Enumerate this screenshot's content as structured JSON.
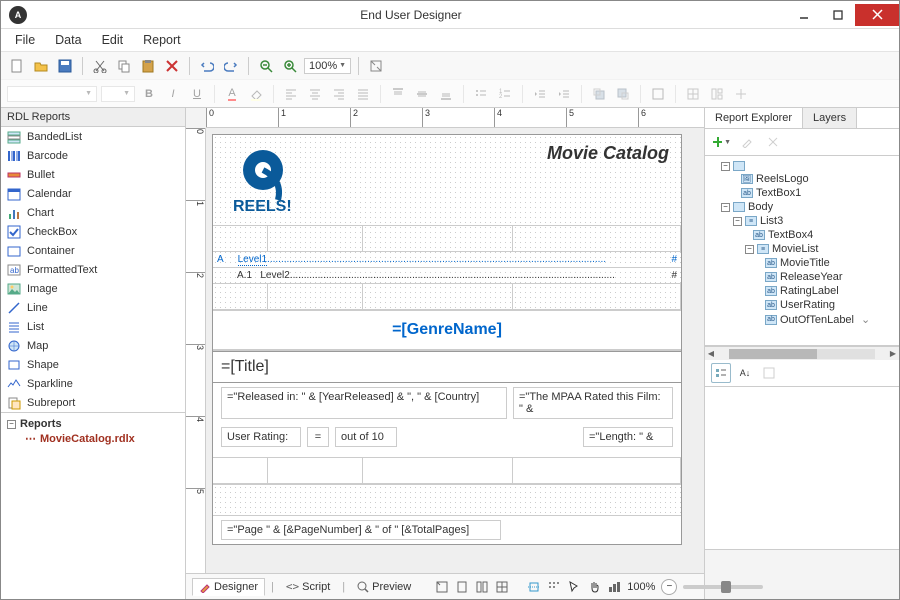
{
  "window": {
    "title": "End User Designer"
  },
  "menu": {
    "file": "File",
    "data": "Data",
    "edit": "Edit",
    "report": "Report"
  },
  "toolbar": {
    "zoom": "100%"
  },
  "left": {
    "header": "RDL Reports",
    "items": [
      {
        "label": "BandedList",
        "icon": "bandedlist"
      },
      {
        "label": "Barcode",
        "icon": "barcode"
      },
      {
        "label": "Bullet",
        "icon": "bullet"
      },
      {
        "label": "Calendar",
        "icon": "calendar"
      },
      {
        "label": "Chart",
        "icon": "chart"
      },
      {
        "label": "CheckBox",
        "icon": "checkbox"
      },
      {
        "label": "Container",
        "icon": "container"
      },
      {
        "label": "FormattedText",
        "icon": "formattedtext"
      },
      {
        "label": "Image",
        "icon": "image"
      },
      {
        "label": "Line",
        "icon": "line"
      },
      {
        "label": "List",
        "icon": "list"
      },
      {
        "label": "Map",
        "icon": "map"
      },
      {
        "label": "Shape",
        "icon": "shape"
      },
      {
        "label": "Sparkline",
        "icon": "sparkline"
      },
      {
        "label": "Subreport",
        "icon": "subreport"
      }
    ],
    "reports_label": "Reports",
    "report_file": "MovieCatalog.rdlx"
  },
  "design": {
    "logo_text": "REELS!",
    "catalog_title": "Movie Catalog",
    "level1": "Level1",
    "level1_marker_left": "A",
    "level1_marker_right": "#",
    "level2": "Level2",
    "level2_marker_left": "A.1",
    "level2_marker_right": "#",
    "genre_expr": "=[GenreName]",
    "title_expr": "=[Title]",
    "released_expr": "=\"Released in: \" & [YearReleased] & \", \" & [Country]",
    "mpaa_expr": "=\"The MPAA Rated this Film: \" &",
    "rating_label": "User Rating:",
    "rating_eq": "=",
    "out_of_ten": "out of 10",
    "length_expr": "=\"Length: \" &",
    "footer_expr": "=\"Page \" & [&PageNumber] & \" of \" [&TotalPages]"
  },
  "bottom": {
    "designer": "Designer",
    "script": "Script",
    "preview": "Preview",
    "zoom": "100%"
  },
  "right": {
    "tab1": "Report Explorer",
    "tab2": "Layers",
    "nodes": {
      "reelslogo": "ReelsLogo",
      "textbox1": "TextBox1",
      "body": "Body",
      "list3": "List3",
      "textbox4": "TextBox4",
      "movielist": "MovieList",
      "movietitle": "MovieTitle",
      "releaseyear": "ReleaseYear",
      "ratinglabel": "RatingLabel",
      "userrating": "UserRating",
      "outoftenlabel": "OutOfTenLabel"
    }
  }
}
